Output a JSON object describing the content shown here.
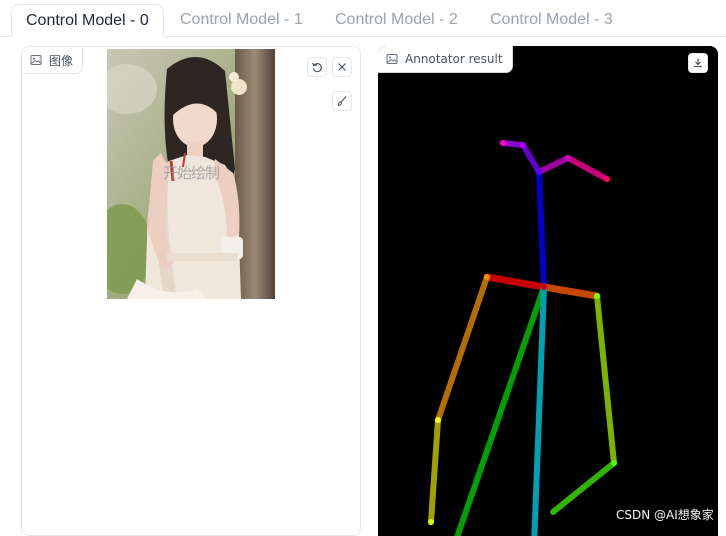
{
  "tabs": [
    {
      "label": "Control Model - 0",
      "active": true
    },
    {
      "label": "Control Model - 1",
      "active": false
    },
    {
      "label": "Control Model - 2",
      "active": false
    },
    {
      "label": "Control Model - 3",
      "active": false
    }
  ],
  "input_panel": {
    "label": "图像",
    "label_icon": "image-icon",
    "watermark_text": "开始绘制",
    "buttons": {
      "reset_icon": "undo-icon",
      "clear_icon": "close-icon",
      "brush_icon": "brush-icon"
    }
  },
  "result_panel": {
    "label": "Annotator result",
    "label_icon": "image-icon",
    "download_icon": "download-icon"
  },
  "credit": "CSDN @AI想象家",
  "colors": {
    "active_tab_text": "#1f2937",
    "inactive_tab_text": "#9ca3af",
    "border": "#e5e7eb",
    "result_background": "#000000"
  }
}
